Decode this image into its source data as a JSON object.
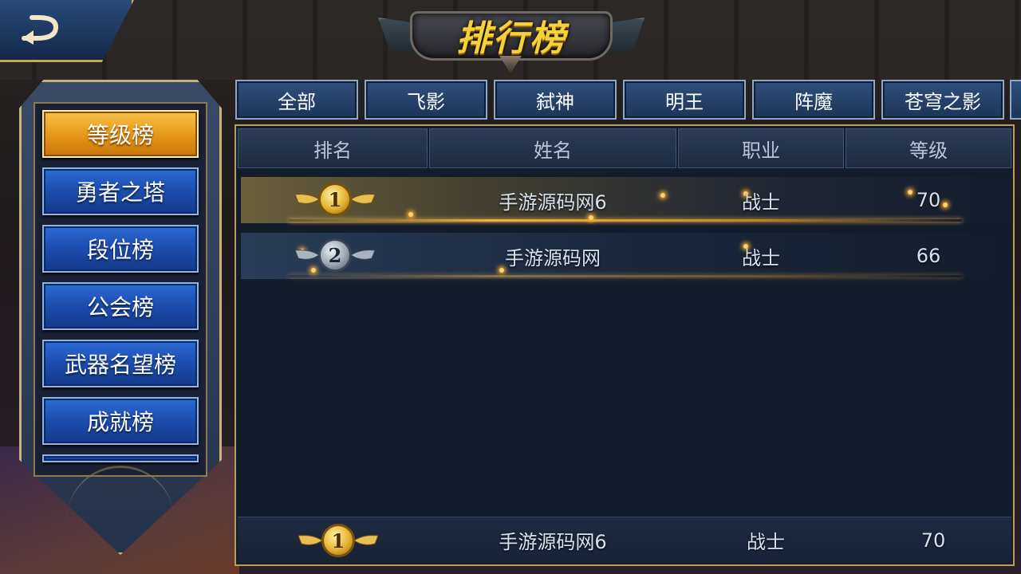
{
  "title": "排行榜",
  "back_button": {
    "icon": "back-arrow-icon"
  },
  "categories": [
    {
      "label": "等级榜",
      "active": true
    },
    {
      "label": "勇者之塔",
      "active": false
    },
    {
      "label": "段位榜",
      "active": false
    },
    {
      "label": "公会榜",
      "active": false
    },
    {
      "label": "武器名望榜",
      "active": false
    },
    {
      "label": "成就榜",
      "active": false
    }
  ],
  "class_tabs": [
    "全部",
    "飞影",
    "弑神",
    "明王",
    "阵魔",
    "苍穹之影"
  ],
  "table": {
    "headers": [
      "排名",
      "姓名",
      "职业",
      "等级"
    ],
    "rows": [
      {
        "rank": "1",
        "medal": "gold",
        "name": "手游源码网6",
        "class": "战士",
        "level": "70"
      },
      {
        "rank": "2",
        "medal": "silver",
        "name": "手游源码网",
        "class": "战士",
        "level": "66"
      }
    ]
  },
  "self_entry": {
    "rank": "1",
    "medal": "gold",
    "name": "手游源码网6",
    "class": "战士",
    "level": "70"
  },
  "colors": {
    "accent_gold": "#f3d23a",
    "active_tab": "#e69a1a",
    "inactive_tab": "#1c4eb0",
    "panel_border": "#b89d5e"
  }
}
